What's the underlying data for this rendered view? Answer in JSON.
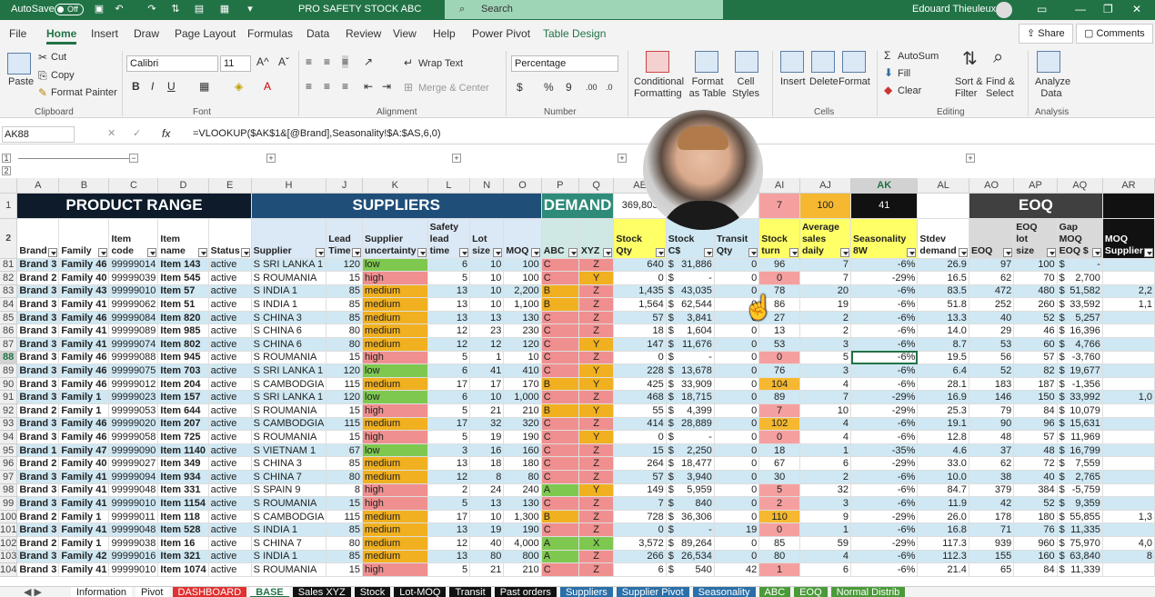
{
  "titlebar": {
    "autosave": "AutoSave",
    "autosave_state": "Off",
    "file_title": "PRO SAFETY STOCK ABC",
    "search_placeholder": "Search",
    "user": "Edouard Thieuleux"
  },
  "menu": {
    "items": [
      "File",
      "Home",
      "Insert",
      "Draw",
      "Page Layout",
      "Formulas",
      "Data",
      "Review",
      "View",
      "Help",
      "Power Pivot",
      "Table Design"
    ],
    "active": "Home",
    "share": "Share",
    "comments": "Comments"
  },
  "ribbon": {
    "clipboard": {
      "paste": "Paste",
      "cut": "Cut",
      "copy": "Copy",
      "format_painter": "Format Painter",
      "label": "Clipboard"
    },
    "font": {
      "name": "Calibri",
      "size": "11",
      "label": "Font"
    },
    "alignment": {
      "wrap": "Wrap Text",
      "merge": "Merge & Center",
      "label": "Alignment"
    },
    "number": {
      "format": "Percentage",
      "label": "Number"
    },
    "styles": {
      "cond": "Conditional Formatting",
      "format_table": "Format as Table",
      "cell_styles": "Cell Styles",
      "label": "Styles"
    },
    "cells": {
      "insert": "Insert",
      "delete": "Delete",
      "format": "Format",
      "label": "Cells"
    },
    "editing": {
      "autosum": "AutoSum",
      "fill": "Fill",
      "clear": "Clear",
      "sort": "Sort & Filter",
      "find": "Find & Select",
      "label": "Editing"
    },
    "analysis": {
      "analyze": "Analyze Data",
      "label": "Analysis"
    }
  },
  "formula_bar": {
    "name_box": "AK88",
    "formula": "=VLOOKUP($AK$1&[@Brand],Seasonality!$A:$AS,6,0)"
  },
  "columns": [
    "A",
    "B",
    "C",
    "D",
    "E",
    "H",
    "J",
    "K",
    "L",
    "N",
    "O",
    "P",
    "Q",
    "AE",
    "AF",
    "AG",
    "AI",
    "AJ",
    "AK",
    "AL",
    "AO",
    "AP",
    "AQ",
    "AR"
  ],
  "selected_column": "AK",
  "sections": {
    "product": "PRODUCT RANGE",
    "suppliers": "SUPPLIERS",
    "demand": "DEMAND",
    "eoq": "EOQ"
  },
  "row1_values": {
    "stock_qty_total": "369,803",
    "ai": "7",
    "aj": "100",
    "ak": "41"
  },
  "headers": [
    "Brand",
    "Family",
    "Item code",
    "Item name",
    "Status",
    "Supplier",
    "Lead Time",
    "Supplier uncertainty",
    "Safety lead time",
    "Lot size",
    "MOQ",
    "ABC",
    "XYZ",
    "Stock Qty",
    "Stock C$",
    "Transit Qty",
    "Stock turn",
    "Average sales daily",
    "Seasonality 8W",
    "Stdev demand",
    "EOQ",
    "EOQ lot size",
    "Gap MOQ EOQ $",
    "MOQ Supplier"
  ],
  "rows": [
    {
      "n": "81",
      "a": "Brand 3",
      "b": "Family 46",
      "c": "99999014",
      "d": "Item 143",
      "e": "active",
      "h": "S SRI LANKA 1",
      "j": "120",
      "k": "low",
      "l": "6",
      "nn": "10",
      "o": "100",
      "p": "C",
      "q": "Z",
      "ae": "640",
      "af": "31,886",
      "ag": "0",
      "ai": "96",
      "aj": "7",
      "ak": "-6%",
      "al": "26.9",
      "ao": "97",
      "ap": "100",
      "aq": "-",
      "ar": ""
    },
    {
      "n": "82",
      "a": "Brand 2",
      "b": "Family 40",
      "c": "99999039",
      "d": "Item 545",
      "e": "active",
      "h": "S ROUMANIA",
      "j": "15",
      "k": "high",
      "l": "5",
      "nn": "10",
      "o": "100",
      "p": "C",
      "q": "Y",
      "ae": "0",
      "af": "-",
      "ag": "0",
      "ai": "0",
      "aj": "7",
      "ak": "-29%",
      "al": "16.5",
      "ao": "62",
      "ap": "70",
      "aq": "2,700",
      "ar": ""
    },
    {
      "n": "83",
      "a": "Brand 3",
      "b": "Family 43",
      "c": "99999010",
      "d": "Item 57",
      "e": "active",
      "h": "S INDIA 1",
      "j": "85",
      "k": "medium",
      "l": "13",
      "nn": "10",
      "o": "2,200",
      "p": "B",
      "q": "Z",
      "ae": "1,435",
      "af": "43,035",
      "ag": "0",
      "ai": "78",
      "aj": "20",
      "ak": "-6%",
      "al": "83.5",
      "ao": "472",
      "ap": "480",
      "aq": "51,582",
      "ar": "2,2"
    },
    {
      "n": "84",
      "a": "Brand 3",
      "b": "Family 41",
      "c": "99999062",
      "d": "Item 51",
      "e": "active",
      "h": "S INDIA 1",
      "j": "85",
      "k": "medium",
      "l": "13",
      "nn": "10",
      "o": "1,100",
      "p": "B",
      "q": "Z",
      "ae": "1,564",
      "af": "62,544",
      "ag": "0",
      "ai": "86",
      "aj": "19",
      "ak": "-6%",
      "al": "51.8",
      "ao": "252",
      "ap": "260",
      "aq": "33,592",
      "ar": "1,1"
    },
    {
      "n": "85",
      "a": "Brand 3",
      "b": "Family 46",
      "c": "99999084",
      "d": "Item 820",
      "e": "active",
      "h": "S CHINA 3",
      "j": "85",
      "k": "medium",
      "l": "13",
      "nn": "13",
      "o": "130",
      "p": "C",
      "q": "Z",
      "ae": "57",
      "af": "3,841",
      "ag": "0",
      "ai": "27",
      "aj": "2",
      "ak": "-6%",
      "al": "13.3",
      "ao": "40",
      "ap": "52",
      "aq": "5,257",
      "ar": ""
    },
    {
      "n": "86",
      "a": "Brand 3",
      "b": "Family 41",
      "c": "99999089",
      "d": "Item 985",
      "e": "active",
      "h": "S CHINA 6",
      "j": "80",
      "k": "medium",
      "l": "12",
      "nn": "23",
      "o": "230",
      "p": "C",
      "q": "Z",
      "ae": "18",
      "af": "1,604",
      "ag": "0",
      "ai": "13",
      "aj": "2",
      "ak": "-6%",
      "al": "14.0",
      "ao": "29",
      "ap": "46",
      "aq": "16,396",
      "ar": ""
    },
    {
      "n": "87",
      "a": "Brand 3",
      "b": "Family 41",
      "c": "99999074",
      "d": "Item 802",
      "e": "active",
      "h": "S CHINA 6",
      "j": "80",
      "k": "medium",
      "l": "12",
      "nn": "12",
      "o": "120",
      "p": "C",
      "q": "Y",
      "ae": "147",
      "af": "11,676",
      "ag": "0",
      "ai": "53",
      "aj": "3",
      "ak": "-6%",
      "al": "8.7",
      "ao": "53",
      "ap": "60",
      "aq": "4,766",
      "ar": ""
    },
    {
      "n": "88",
      "a": "Brand 3",
      "b": "Family 46",
      "c": "99999088",
      "d": "Item 945",
      "e": "active",
      "h": "S ROUMANIA",
      "j": "15",
      "k": "high",
      "l": "5",
      "nn": "1",
      "o": "10",
      "p": "C",
      "q": "Z",
      "ae": "0",
      "af": "-",
      "ag": "0",
      "ai": "0",
      "aj": "5",
      "ak": "-6%",
      "al": "19.5",
      "ao": "56",
      "ap": "57",
      "aq": "-3,760",
      "ar": ""
    },
    {
      "n": "89",
      "a": "Brand 3",
      "b": "Family 46",
      "c": "99999075",
      "d": "Item 703",
      "e": "active",
      "h": "S SRI LANKA 1",
      "j": "120",
      "k": "low",
      "l": "6",
      "nn": "41",
      "o": "410",
      "p": "C",
      "q": "Y",
      "ae": "228",
      "af": "13,678",
      "ag": "0",
      "ai": "76",
      "aj": "3",
      "ak": "-6%",
      "al": "6.4",
      "ao": "52",
      "ap": "82",
      "aq": "19,677",
      "ar": ""
    },
    {
      "n": "90",
      "a": "Brand 3",
      "b": "Family 46",
      "c": "99999012",
      "d": "Item 204",
      "e": "active",
      "h": "S CAMBODGIA",
      "j": "115",
      "k": "medium",
      "l": "17",
      "nn": "17",
      "o": "170",
      "p": "B",
      "q": "Y",
      "ae": "425",
      "af": "33,909",
      "ag": "0",
      "ai": "104",
      "aj": "4",
      "ak": "-6%",
      "al": "28.1",
      "ao": "183",
      "ap": "187",
      "aq": "-1,356",
      "ar": ""
    },
    {
      "n": "91",
      "a": "Brand 3",
      "b": "Family 1",
      "c": "99999023",
      "d": "Item 157",
      "e": "active",
      "h": "S SRI LANKA 1",
      "j": "120",
      "k": "low",
      "l": "6",
      "nn": "10",
      "o": "1,000",
      "p": "C",
      "q": "Z",
      "ae": "468",
      "af": "18,715",
      "ag": "0",
      "ai": "89",
      "aj": "7",
      "ak": "-29%",
      "al": "16.9",
      "ao": "146",
      "ap": "150",
      "aq": "33,992",
      "ar": "1,0"
    },
    {
      "n": "92",
      "a": "Brand 2",
      "b": "Family 1",
      "c": "99999053",
      "d": "Item 644",
      "e": "active",
      "h": "S ROUMANIA",
      "j": "15",
      "k": "high",
      "l": "5",
      "nn": "21",
      "o": "210",
      "p": "B",
      "q": "Y",
      "ae": "55",
      "af": "4,399",
      "ag": "0",
      "ai": "7",
      "aj": "10",
      "ak": "-29%",
      "al": "25.3",
      "ao": "79",
      "ap": "84",
      "aq": "10,079",
      "ar": ""
    },
    {
      "n": "93",
      "a": "Brand 3",
      "b": "Family 46",
      "c": "99999020",
      "d": "Item 207",
      "e": "active",
      "h": "S CAMBODGIA",
      "j": "115",
      "k": "medium",
      "l": "17",
      "nn": "32",
      "o": "320",
      "p": "C",
      "q": "Z",
      "ae": "414",
      "af": "28,889",
      "ag": "0",
      "ai": "102",
      "aj": "4",
      "ak": "-6%",
      "al": "19.1",
      "ao": "90",
      "ap": "96",
      "aq": "15,631",
      "ar": ""
    },
    {
      "n": "94",
      "a": "Brand 3",
      "b": "Family 46",
      "c": "99999058",
      "d": "Item 725",
      "e": "active",
      "h": "S ROUMANIA",
      "j": "15",
      "k": "high",
      "l": "5",
      "nn": "19",
      "o": "190",
      "p": "C",
      "q": "Y",
      "ae": "0",
      "af": "-",
      "ag": "0",
      "ai": "0",
      "aj": "4",
      "ak": "-6%",
      "al": "12.8",
      "ao": "48",
      "ap": "57",
      "aq": "11,969",
      "ar": ""
    },
    {
      "n": "95",
      "a": "Brand 1",
      "b": "Family 47",
      "c": "99999090",
      "d": "Item 1140",
      "e": "active",
      "h": "S VIETNAM 1",
      "j": "67",
      "k": "low",
      "l": "3",
      "nn": "16",
      "o": "160",
      "p": "C",
      "q": "Z",
      "ae": "15",
      "af": "2,250",
      "ag": "0",
      "ai": "18",
      "aj": "1",
      "ak": "-35%",
      "al": "4.6",
      "ao": "37",
      "ap": "48",
      "aq": "16,799",
      "ar": ""
    },
    {
      "n": "96",
      "a": "Brand 2",
      "b": "Family 40",
      "c": "99999027",
      "d": "Item 349",
      "e": "active",
      "h": "S CHINA 3",
      "j": "85",
      "k": "medium",
      "l": "13",
      "nn": "18",
      "o": "180",
      "p": "C",
      "q": "Z",
      "ae": "264",
      "af": "18,477",
      "ag": "0",
      "ai": "67",
      "aj": "6",
      "ak": "-29%",
      "al": "33.0",
      "ao": "62",
      "ap": "72",
      "aq": "7,559",
      "ar": ""
    },
    {
      "n": "97",
      "a": "Brand 3",
      "b": "Family 41",
      "c": "99999094",
      "d": "Item 934",
      "e": "active",
      "h": "S CHINA 7",
      "j": "80",
      "k": "medium",
      "l": "12",
      "nn": "8",
      "o": "80",
      "p": "C",
      "q": "Z",
      "ae": "57",
      "af": "3,940",
      "ag": "0",
      "ai": "30",
      "aj": "2",
      "ak": "-6%",
      "al": "10.0",
      "ao": "38",
      "ap": "40",
      "aq": "2,765",
      "ar": ""
    },
    {
      "n": "98",
      "a": "Brand 3",
      "b": "Family 41",
      "c": "99999048",
      "d": "Item 331",
      "e": "active",
      "h": "S SPAIN 9",
      "j": "8",
      "k": "high",
      "l": "2",
      "nn": "24",
      "o": "240",
      "p": "A",
      "q": "Y",
      "ae": "149",
      "af": "5,959",
      "ag": "0",
      "ai": "5",
      "aj": "32",
      "ak": "-6%",
      "al": "84.7",
      "ao": "379",
      "ap": "384",
      "aq": "-5,759",
      "ar": ""
    },
    {
      "n": "99",
      "a": "Brand 3",
      "b": "Family 41",
      "c": "99999010",
      "d": "Item 1154",
      "e": "active",
      "h": "S ROUMANIA",
      "j": "15",
      "k": "high",
      "l": "5",
      "nn": "13",
      "o": "130",
      "p": "C",
      "q": "Z",
      "ae": "7",
      "af": "840",
      "ag": "0",
      "ai": "2",
      "aj": "3",
      "ak": "-6%",
      "al": "11.9",
      "ao": "42",
      "ap": "52",
      "aq": "9,359",
      "ar": ""
    },
    {
      "n": "100",
      "a": "Brand 2",
      "b": "Family 1",
      "c": "99999011",
      "d": "Item 118",
      "e": "active",
      "h": "S CAMBODGIA",
      "j": "115",
      "k": "medium",
      "l": "17",
      "nn": "10",
      "o": "1,300",
      "p": "B",
      "q": "Z",
      "ae": "728",
      "af": "36,306",
      "ag": "0",
      "ai": "110",
      "aj": "9",
      "ak": "-29%",
      "al": "26.0",
      "ao": "178",
      "ap": "180",
      "aq": "55,855",
      "ar": "1,3"
    },
    {
      "n": "101",
      "a": "Brand 3",
      "b": "Family 41",
      "c": "99999048",
      "d": "Item 528",
      "e": "active",
      "h": "S INDIA 1",
      "j": "85",
      "k": "medium",
      "l": "13",
      "nn": "19",
      "o": "190",
      "p": "C",
      "q": "Z",
      "ae": "0",
      "af": "-",
      "ag": "19",
      "ai": "0",
      "aj": "1",
      "ak": "-6%",
      "al": "16.8",
      "ao": "71",
      "ap": "76",
      "aq": "11,335",
      "ar": ""
    },
    {
      "n": "102",
      "a": "Brand 2",
      "b": "Family 1",
      "c": "99999038",
      "d": "Item 16",
      "e": "active",
      "h": "S CHINA 7",
      "j": "80",
      "k": "medium",
      "l": "12",
      "nn": "40",
      "o": "4,000",
      "p": "A",
      "q": "X",
      "ae": "3,572",
      "af": "89,264",
      "ag": "0",
      "ai": "85",
      "aj": "59",
      "ak": "-29%",
      "al": "117.3",
      "ao": "939",
      "ap": "960",
      "aq": "75,970",
      "ar": "4,0"
    },
    {
      "n": "103",
      "a": "Brand 3",
      "b": "Family 42",
      "c": "99999016",
      "d": "Item 321",
      "e": "active",
      "h": "S INDIA 1",
      "j": "85",
      "k": "medium",
      "l": "13",
      "nn": "80",
      "o": "800",
      "p": "A",
      "q": "Z",
      "ae": "266",
      "af": "26,534",
      "ag": "0",
      "ai": "80",
      "aj": "4",
      "ak": "-6%",
      "al": "112.3",
      "ao": "155",
      "ap": "160",
      "aq": "63,840",
      "ar": "8"
    },
    {
      "n": "104",
      "a": "Brand 3",
      "b": "Family 41",
      "c": "99999010",
      "d": "Item 1074",
      "e": "active",
      "h": "S ROUMANIA",
      "j": "15",
      "k": "high",
      "l": "5",
      "nn": "21",
      "o": "210",
      "p": "C",
      "q": "Z",
      "ae": "6",
      "af": "540",
      "ag": "42",
      "ai": "1",
      "aj": "6",
      "ak": "-6%",
      "al": "21.4",
      "ao": "65",
      "ap": "84",
      "aq": "11,339",
      "ar": ""
    }
  ],
  "sheet_tabs": [
    {
      "label": "Information",
      "color": "#ffffff",
      "text": "#222"
    },
    {
      "label": "Pivot",
      "color": "#ffffff",
      "text": "#222"
    },
    {
      "label": "DASHBOARD",
      "color": "#e03030",
      "text": "#fff"
    },
    {
      "label": "BASE",
      "color": "#ffffff",
      "text": "#217346"
    },
    {
      "label": "Sales XYZ",
      "color": "#111111",
      "text": "#fff"
    },
    {
      "label": "Stock",
      "color": "#111111",
      "text": "#fff"
    },
    {
      "label": "Lot-MOQ",
      "color": "#111111",
      "text": "#fff"
    },
    {
      "label": "Transit",
      "color": "#111111",
      "text": "#fff"
    },
    {
      "label": "Past orders",
      "color": "#111111",
      "text": "#fff"
    },
    {
      "label": "Suppliers",
      "color": "#2a6fa8",
      "text": "#fff"
    },
    {
      "label": "Supplier Pivot",
      "color": "#2a6fa8",
      "text": "#fff"
    },
    {
      "label": "Seasonality",
      "color": "#2a6fa8",
      "text": "#fff"
    },
    {
      "label": "ABC",
      "color": "#4a9a3a",
      "text": "#fff"
    },
    {
      "label": "EOQ",
      "color": "#4a9a3a",
      "text": "#fff"
    },
    {
      "label": "Normal Distrib",
      "color": "#4a9a3a",
      "text": "#fff"
    }
  ],
  "colors": {
    "excel_green": "#217346",
    "navy": "#0d1b2a",
    "suppliers_blue": "#1f4e79",
    "demand_teal": "#2e8b7a",
    "yellow": "#ffff66",
    "eoq_grey": "#404040"
  }
}
